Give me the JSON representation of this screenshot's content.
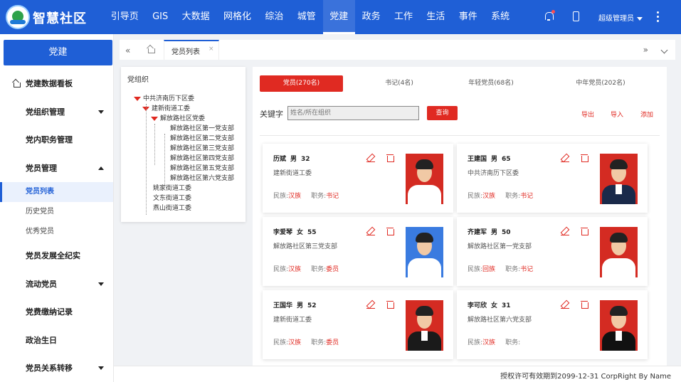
{
  "header": {
    "app_title": "智慧社区",
    "nav": [
      "引导页",
      "GIS",
      "大数据",
      "网格化",
      "综治",
      "城管",
      "党建",
      "政务",
      "工作",
      "生活",
      "事件",
      "系统"
    ],
    "active_nav": "党建",
    "user": "超级管理员"
  },
  "sidebar": {
    "title": "党建",
    "items": [
      {
        "label": "党建数据看板",
        "icon": "home-icon"
      },
      {
        "label": "党组织管理",
        "arrow": "down"
      },
      {
        "label": "党内职务管理"
      },
      {
        "label": "党员管理",
        "arrow": "up"
      },
      {
        "label": "党员发展全纪实"
      },
      {
        "label": "流动党员",
        "arrow": "down"
      },
      {
        "label": "党费缴纳记录"
      },
      {
        "label": "政治生日"
      },
      {
        "label": "党员关系转移",
        "arrow": "down"
      }
    ],
    "subitems": [
      "党员列表",
      "历史党员",
      "优秀党员"
    ],
    "active_subitem": "党员列表"
  },
  "tabs": {
    "active_tab": "党员列表",
    "close": "×",
    "prev": "«",
    "next": "»"
  },
  "org": {
    "title": "党组织",
    "tree": [
      {
        "label": "中共济南历下区委",
        "level": 0,
        "expanded": true
      },
      {
        "label": "建新街道工委",
        "level": 1,
        "expanded": true
      },
      {
        "label": "解放路社区党委",
        "level": 2,
        "expanded": true
      },
      {
        "label": "解放路社区第一党支部",
        "level": 3
      },
      {
        "label": "解放路社区第二党支部",
        "level": 3
      },
      {
        "label": "解放路社区第三党支部",
        "level": 3
      },
      {
        "label": "解放路社区第四党支部",
        "level": 3
      },
      {
        "label": "解放路社区第五党支部",
        "level": 3
      },
      {
        "label": "解放路社区第六党支部",
        "level": 3
      },
      {
        "label": "姚家街道工委",
        "level": 1
      },
      {
        "label": "文东街道工委",
        "level": 1
      },
      {
        "label": "燕山街道工委",
        "level": 1
      }
    ]
  },
  "members_panel": {
    "categories": [
      "党员(270名)",
      "书记(4名)",
      "年轻党员(68名)",
      "中年党员(202名)"
    ],
    "active_category": "党员(270名)",
    "keyword_label": "关键字",
    "search_placeholder": "姓名/所在组织",
    "search_button": "查询",
    "actions": [
      "导出",
      "导入",
      "添加"
    ],
    "ethnicity_label": "民族:",
    "position_label": "职务:",
    "members": [
      {
        "name": "历斌",
        "gender": "男",
        "age": "32",
        "org": "建新街道工委",
        "ethnicity": "汉族",
        "position": "书记",
        "photo_bg": "#d42b22",
        "shirt": "#ffffff"
      },
      {
        "name": "王建国",
        "gender": "男",
        "age": "65",
        "org": "中共济南历下区委",
        "ethnicity": "汉族",
        "position": "书记",
        "photo_bg": "#d42b22",
        "shirt": "#1a2a4a"
      },
      {
        "name": "李爱琴",
        "gender": "女",
        "age": "55",
        "org": "解放路社区第三党支部",
        "ethnicity": "汉族",
        "position": "委员",
        "photo_bg": "#3a7be0",
        "shirt": "#ffffff"
      },
      {
        "name": "齐建军",
        "gender": "男",
        "age": "50",
        "org": "解放路社区第一党支部",
        "ethnicity": "回族",
        "position": "书记",
        "photo_bg": "#d42b22",
        "shirt": "#ffffff"
      },
      {
        "name": "王国华",
        "gender": "男",
        "age": "52",
        "org": "建新街道工委",
        "ethnicity": "汉族",
        "position": "委员",
        "photo_bg": "#d42b22",
        "shirt": "#1a1a1a"
      },
      {
        "name": "李可欣",
        "gender": "女",
        "age": "31",
        "org": "解放路社区第六党支部",
        "ethnicity": "汉族",
        "position": "",
        "photo_bg": "#d42b22",
        "shirt": "#111111"
      }
    ]
  },
  "footer": {
    "text": "授权许可有效期到2099-12-31 CorpRight By Name"
  },
  "colors": {
    "primary": "#1f5fd6",
    "accent_red": "#e02a22"
  }
}
